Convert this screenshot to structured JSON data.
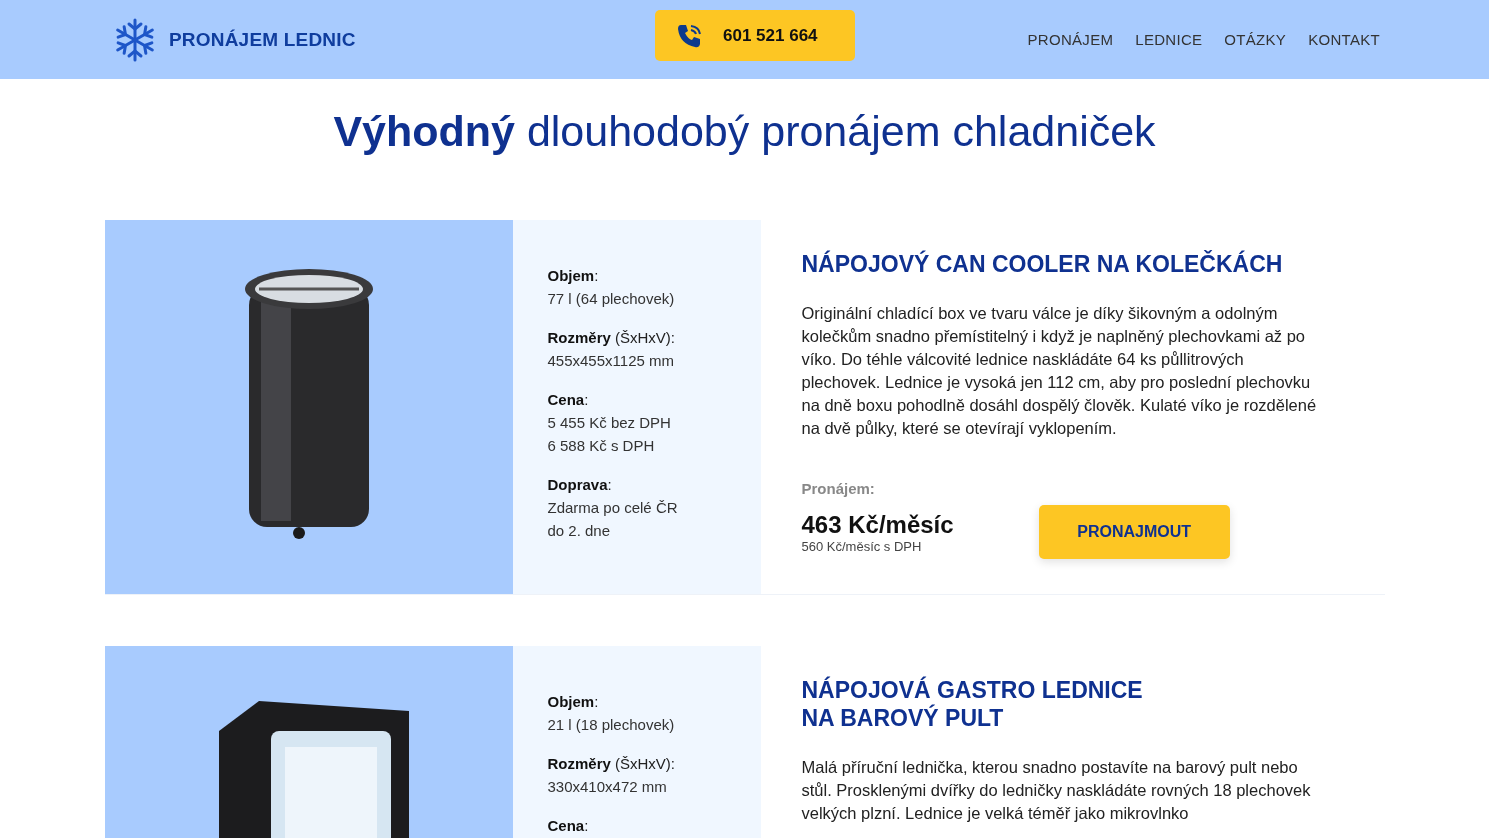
{
  "header": {
    "logo_text": "PRONÁJEM LEDNIC",
    "phone": "601 521 664",
    "nav": [
      "PRONÁJEM",
      "LEDNICE",
      "OTÁZKY",
      "KONTAKT"
    ]
  },
  "title": "**Výhodný** dlouhodobý pronájem chladniček",
  "products": [
    {
      "kind": "cylinder",
      "name_lines": [
        "NÁPOJOVÝ CAN COOLER NA KOLEČKÁCH"
      ],
      "specs": [
        {
          "label": "**Objem**:",
          "values": [
            "77 l (64 plechovek)"
          ]
        },
        {
          "label": "**Rozměry** (ŠxHxV):",
          "values": [
            "455x455x1125 mm"
          ]
        },
        {
          "label": "**Cena**:",
          "values": [
            "5 455 Kč bez DPH",
            "6 588 Kč s DPH"
          ]
        },
        {
          "label": "**Doprava**:",
          "values": [
            "Zdarma po celé ČR",
            "do 2. dne"
          ]
        }
      ],
      "description": "Originální chladící box ve tvaru válce je díky šikovným a odolným kolečkům snadno přemístitelný i když je naplněný plechovkami až po víko. Do téhle válcovité lednice naskládáte 64 ks půllitrových plechovek. Lednice je vysoká jen 112 cm, aby pro poslední plechovku na dně boxu pohodlně dosáhl dospělý člověk. Kulaté víko je rozdělené na dvě půlky, které se otevírají vyklopením.",
      "rent_label": "Pronájem:",
      "price": "463 Kč/měsíc",
      "price_vat": "560 Kč/měsíc s DPH",
      "button": "PRONAJMOUT"
    },
    {
      "kind": "glass-door",
      "name_lines": [
        "NÁPOJOVÁ GASTRO LEDNICE",
        "NA BAROVÝ PULT"
      ],
      "specs": [
        {
          "label": "**Objem**:",
          "values": [
            "21 l (18 plechovek)"
          ]
        },
        {
          "label": "**Rozměry** (ŠxHxV):",
          "values": [
            "330x410x472 mm"
          ]
        },
        {
          "label": "**Cena**:"
        }
      ],
      "description": "Malá příruční lednička, kterou snadno postavíte na barový pult nebo stůl. Prosklenými dvířky do ledničky naskládáte rovných 18 plechovek velkých plzní. Lednice je velká téměř jako mikrovlnko"
    }
  ]
}
